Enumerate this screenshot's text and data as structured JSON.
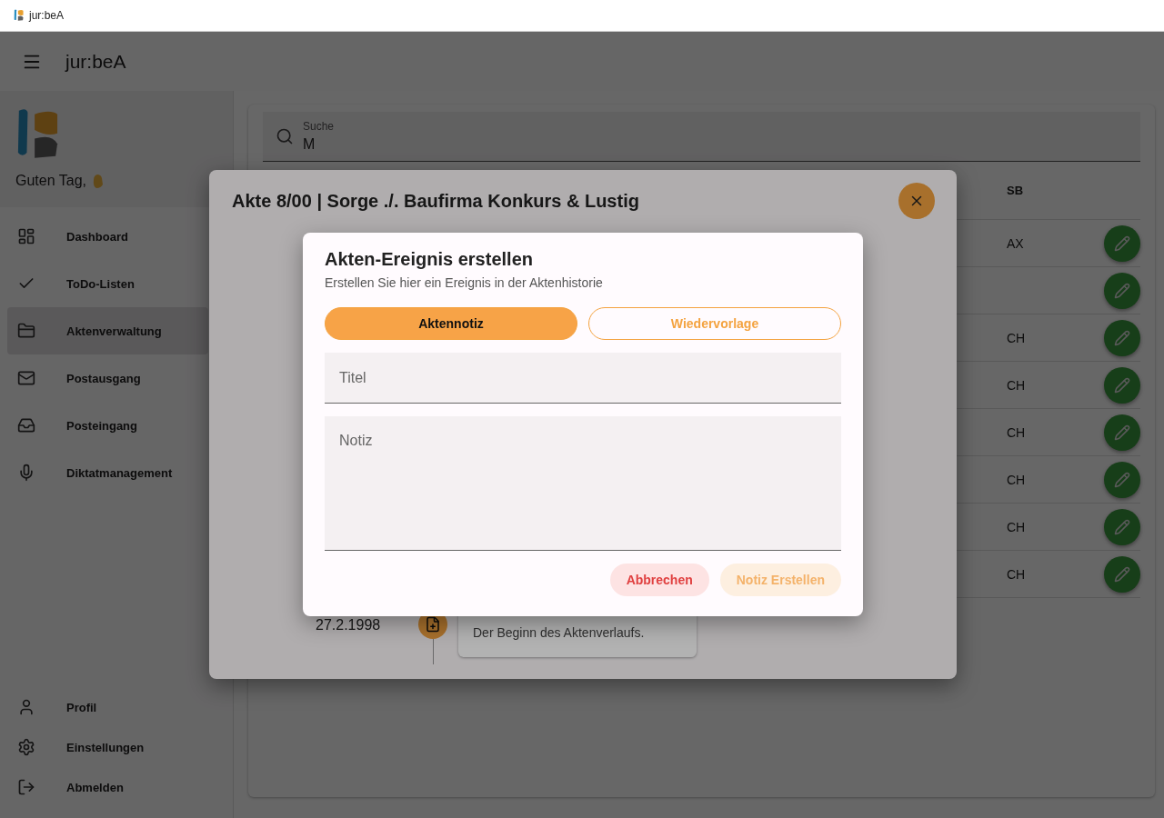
{
  "browser": {
    "title": "jur:beA"
  },
  "app_bar": {
    "title": "jur:beA"
  },
  "sidebar": {
    "greeting": "Guten Tag,",
    "items": [
      {
        "label": "Dashboard",
        "selected": false
      },
      {
        "label": "ToDo-Listen",
        "selected": false
      },
      {
        "label": "Aktenverwaltung",
        "selected": true
      },
      {
        "label": "Postausgang",
        "selected": false
      },
      {
        "label": "Posteingang",
        "selected": false
      },
      {
        "label": "Diktatmanagement",
        "selected": false
      }
    ],
    "bottom_items": [
      {
        "label": "Profil"
      },
      {
        "label": "Einstellungen"
      },
      {
        "label": "Abmelden"
      }
    ]
  },
  "search": {
    "label": "Suche",
    "value": "M"
  },
  "table": {
    "columns": [
      "SB"
    ],
    "rows": [
      {
        "sb": "AX"
      },
      {
        "sb": ""
      },
      {
        "sb": "CH"
      },
      {
        "sb": "CH"
      },
      {
        "sb": "CH"
      },
      {
        "sb": "CH"
      },
      {
        "sb": "CH"
      },
      {
        "sb": "CH"
      }
    ]
  },
  "file_dialog": {
    "title": "Akte 8/00 | Sorge ./. Baufirma Konkurs & Lustig",
    "timeline": [
      {
        "date": "27.2.1998",
        "description": "Der Beginn des Aktenverlaufs."
      }
    ]
  },
  "event_dialog": {
    "title": "Akten-Ereignis erstellen",
    "subtitle": "Erstellen Sie hier ein Ereignis in der Aktenhistorie",
    "types": [
      {
        "label": "Aktennotiz",
        "selected": true
      },
      {
        "label": "Wiedervorlage",
        "selected": false
      }
    ],
    "fields": [
      {
        "kind": "line",
        "placeholder": "Titel"
      },
      {
        "kind": "area",
        "placeholder": "Notiz"
      }
    ],
    "actions": [
      {
        "kind": "cancel",
        "label": "Abbrechen"
      },
      {
        "kind": "submit",
        "label": "Notiz Erstellen"
      }
    ]
  }
}
